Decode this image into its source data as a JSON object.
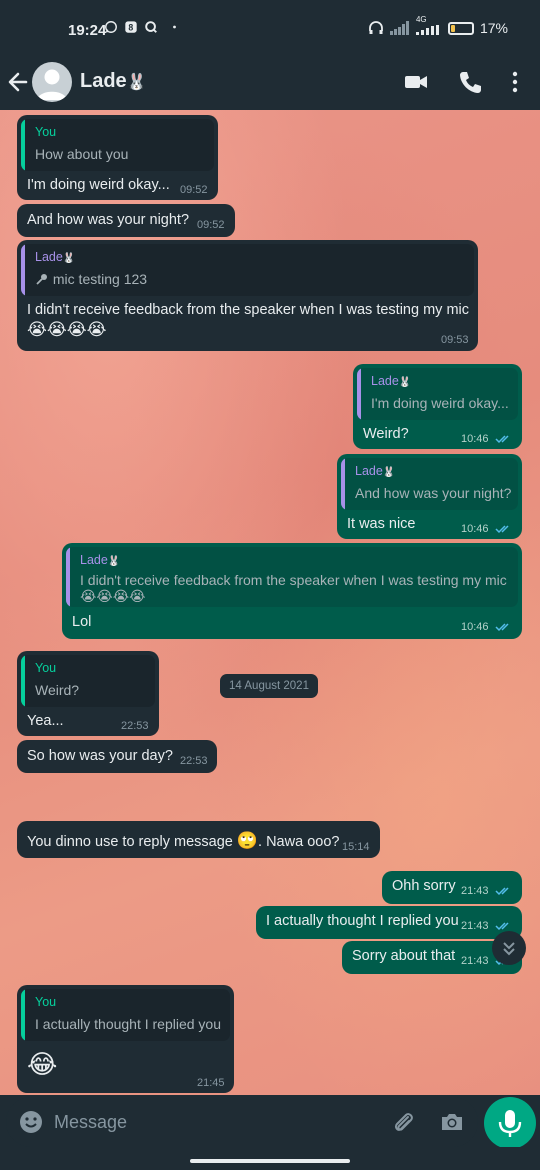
{
  "status_bar": {
    "time": "19:24",
    "network": "4G",
    "battery": "17%",
    "battery_level": 0.17,
    "icons": [
      "whatsapp-icon",
      "app-icon",
      "search-app-icon",
      "dot-icon",
      "headphones-icon",
      "signal-icon",
      "signal-icon"
    ]
  },
  "header": {
    "contact_name": "Lade",
    "name_emoji": "🐰",
    "icons": [
      "back-arrow-icon",
      "avatar-icon",
      "video-call-icon",
      "phone-icon",
      "more-vert-icon"
    ]
  },
  "messages": [
    {
      "dir": "in",
      "quote": {
        "sender": "You",
        "text": "How about you"
      },
      "text": "I'm doing weird okay...",
      "time": "09:52"
    },
    {
      "dir": "in",
      "text": "And how was your night?",
      "time": "09:52"
    },
    {
      "dir": "in",
      "quote": {
        "sender": "Lade",
        "sender_emoji": "🐰",
        "icon": "mic-icon",
        "text": "mic testing 123"
      },
      "text": "I didn't receive feedback from the speaker when I was testing my mic",
      "emoji_line": "😭😭😭😭",
      "time": "09:53"
    },
    {
      "dir": "out",
      "quote": {
        "sender": "Lade",
        "sender_emoji": "🐰",
        "text": "I'm doing weird okay..."
      },
      "text": "Weird?",
      "time": "10:46"
    },
    {
      "dir": "out",
      "quote": {
        "sender": "Lade",
        "sender_emoji": "🐰",
        "text": "And how was your night?"
      },
      "text": "It was nice",
      "time": "10:46"
    },
    {
      "dir": "out",
      "quote": {
        "sender": "Lade",
        "sender_emoji": "🐰",
        "text": "I didn't receive feedback from the speaker when I was testing my mic",
        "emoji_line": "😭😭😭😭"
      },
      "text": "Lol",
      "time": "10:46"
    },
    {
      "dir": "in",
      "quote": {
        "sender": "You",
        "text": "Weird?"
      },
      "text": "Yea...",
      "time": "22:53"
    },
    {
      "dir": "in",
      "text": "So how was your day?",
      "time": "22:53"
    },
    {
      "dir": "in",
      "text": "You dinno use to reply message",
      "emoji": "🙄",
      "text_after": ". Nawa ooo?",
      "time": "15:14"
    },
    {
      "dir": "out",
      "text": "Ohh sorry",
      "time": "21:43"
    },
    {
      "dir": "out",
      "text": "I actually thought I replied you",
      "time": "21:43"
    },
    {
      "dir": "out",
      "text": "Sorry about that",
      "time": "21:43"
    },
    {
      "dir": "in",
      "quote": {
        "sender": "You",
        "text": "I actually thought I replied you"
      },
      "emoji_only": "😂",
      "time": "21:45"
    }
  ],
  "date_chip": "14 August 2021",
  "composer": {
    "placeholder": "Message",
    "icons": [
      "emoji-icon",
      "attach-icon",
      "camera-icon",
      "mic-icon"
    ]
  },
  "colors": {
    "app_bar": "#1f2c34",
    "incoming_bubble": "#1f2c34",
    "outgoing_bubble": "#005c4b",
    "accent": "#00a884",
    "quote_you": "#06cf9c",
    "quote_lade": "#a791e9",
    "read_ticks": "#53bdeb"
  }
}
